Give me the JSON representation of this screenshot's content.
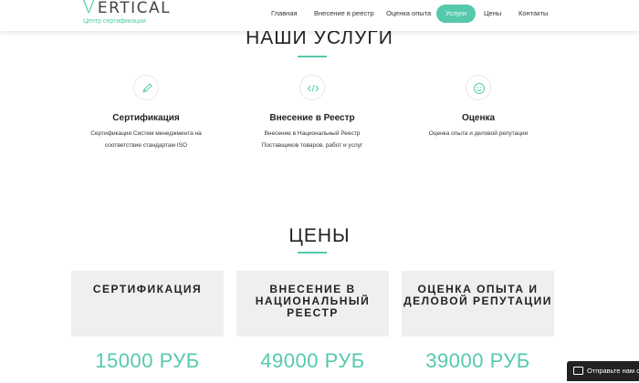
{
  "header": {
    "logo_rest": "ERTICAL",
    "logo_v": "V",
    "logo_subtitle": "Центр сертификации",
    "nav": [
      {
        "label": "Главная",
        "active": false
      },
      {
        "label": "Внесение в реестр",
        "active": false
      },
      {
        "label": "Оценка опыта",
        "active": false
      },
      {
        "label": "Услуги",
        "active": true
      },
      {
        "label": "Цены",
        "active": false
      },
      {
        "label": "Контакты",
        "active": false
      }
    ]
  },
  "services": {
    "title": "НАШИ УСЛУГИ",
    "items": [
      {
        "icon": "pencil-icon",
        "title": "Сертификация",
        "desc1": "Сертификация Систем менеджмента на",
        "desc2": "соответствие стандартам ISO"
      },
      {
        "icon": "code-icon",
        "title": "Внесение в Реестр",
        "desc1": "Внесение в Национальный Реестр",
        "desc2": "Поставщиков товаров, работ и услуг"
      },
      {
        "icon": "smile-icon",
        "title": "Оценка",
        "desc1": "Оценка опыта и деловой репутации",
        "desc2": ""
      }
    ]
  },
  "prices": {
    "title": "ЦЕНЫ",
    "items": [
      {
        "line1": "СЕРТИФИКАЦИЯ",
        "line2": "",
        "line3": "",
        "price": "15000 РУБ"
      },
      {
        "line1": "ВНЕСЕНИЕ В",
        "line2": "НАЦИОНАЛЬНЫЙ",
        "line3": "РЕЕСТР",
        "price": "49000 РУБ"
      },
      {
        "line1": "ОЦЕНКА ОПЫТА И",
        "line2": "ДЕЛОВОЙ РЕПУТАЦИИ",
        "line3": "",
        "price": "39000 РУБ"
      }
    ]
  },
  "chat": {
    "label": "Отправьте нам сообщение"
  },
  "colors": {
    "accent": "#55c9ac",
    "card_bg": "#efefef",
    "chat_bg": "#222222"
  }
}
